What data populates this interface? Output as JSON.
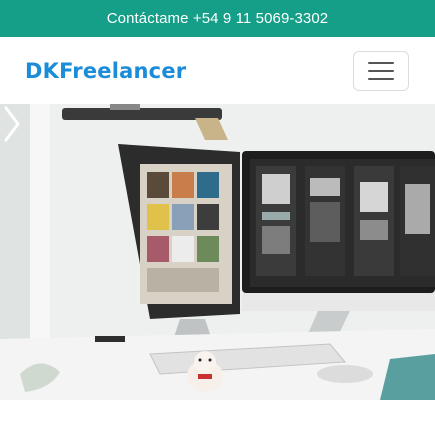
{
  "topbar": {
    "contact_text": "Contáctame +54 9 11 5069-3302"
  },
  "navbar": {
    "brand": "DKFreelancer",
    "menu_icon": "hamburger-icon"
  },
  "carousel": {
    "next_icon": "chevron-right-icon",
    "image_subject": "desk-with-monitors"
  },
  "colors": {
    "topbar_bg": "#159f88",
    "brand": "#1a8cd8"
  }
}
